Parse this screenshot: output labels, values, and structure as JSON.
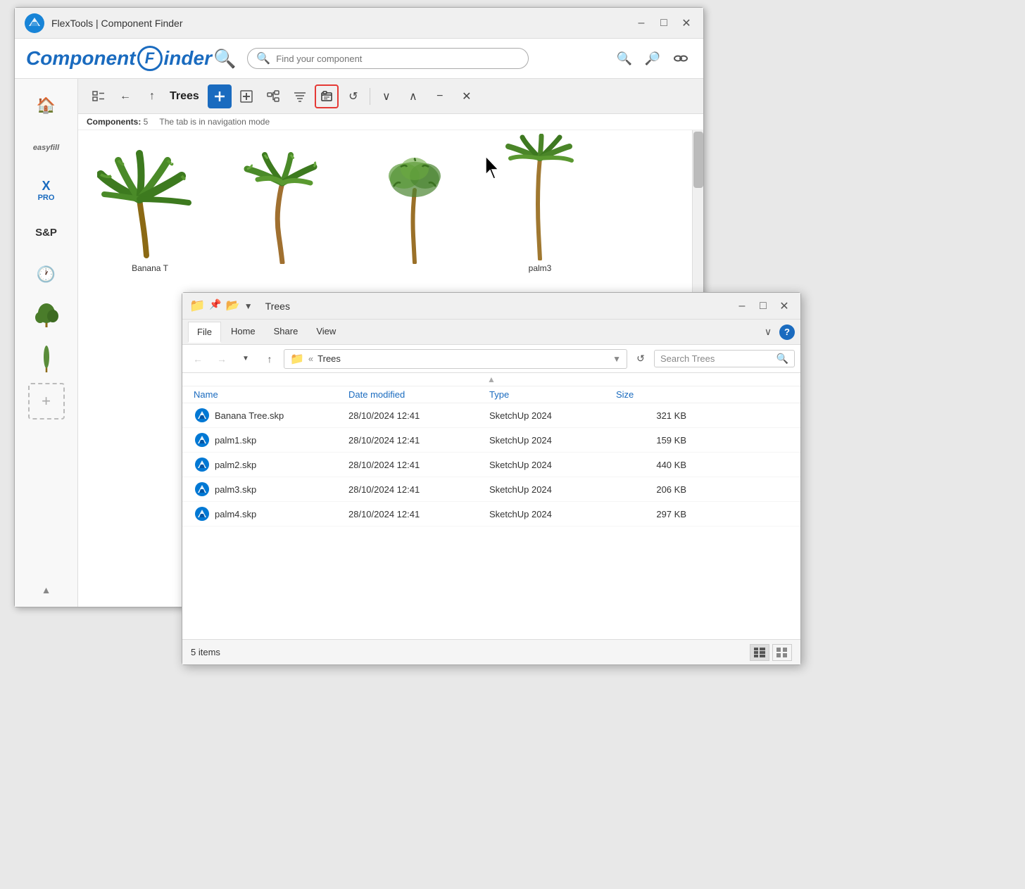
{
  "app": {
    "title": "FlexTools | Component Finder",
    "logo_main": "Component",
    "logo_f": "F",
    "logo_finder": "Finder"
  },
  "header": {
    "search_placeholder": "Find your component"
  },
  "toolbar": {
    "title": "Trees",
    "components_label": "Components:",
    "components_count": "5",
    "status_text": "The tab is in navigation mode"
  },
  "component_grid": {
    "items": [
      {
        "name": "Banana T"
      },
      {
        "name": ""
      },
      {
        "name": ""
      },
      {
        "name": "palm3"
      }
    ]
  },
  "file_explorer": {
    "title": "Trees",
    "ribbon_tabs": [
      "File",
      "Home",
      "Share",
      "View"
    ],
    "active_tab": "File",
    "address": "Trees",
    "search_placeholder": "Search Trees",
    "search_value": "Search Trees",
    "columns": {
      "name": "Name",
      "date": "Date modified",
      "type": "Type",
      "size": "Size"
    },
    "files": [
      {
        "name": "Banana Tree.skp",
        "date": "28/10/2024 12:41",
        "type": "SketchUp 2024",
        "size": "321 KB"
      },
      {
        "name": "palm1.skp",
        "date": "28/10/2024 12:41",
        "type": "SketchUp 2024",
        "size": "159 KB"
      },
      {
        "name": "palm2.skp",
        "date": "28/10/2024 12:41",
        "type": "SketchUp 2024",
        "size": "440 KB"
      },
      {
        "name": "palm3.skp",
        "date": "28/10/2024 12:41",
        "type": "SketchUp 2024",
        "size": "206 KB"
      },
      {
        "name": "palm4.skp",
        "date": "28/10/2024 12:41",
        "type": "SketchUp 2024",
        "size": "297 KB"
      }
    ],
    "status": "5 items"
  },
  "sidebar": {
    "easyfill_label": "easyfill",
    "xpro_label": "X\nPRO",
    "sp_label": "S&P",
    "history_label": "",
    "add_label": "+"
  }
}
